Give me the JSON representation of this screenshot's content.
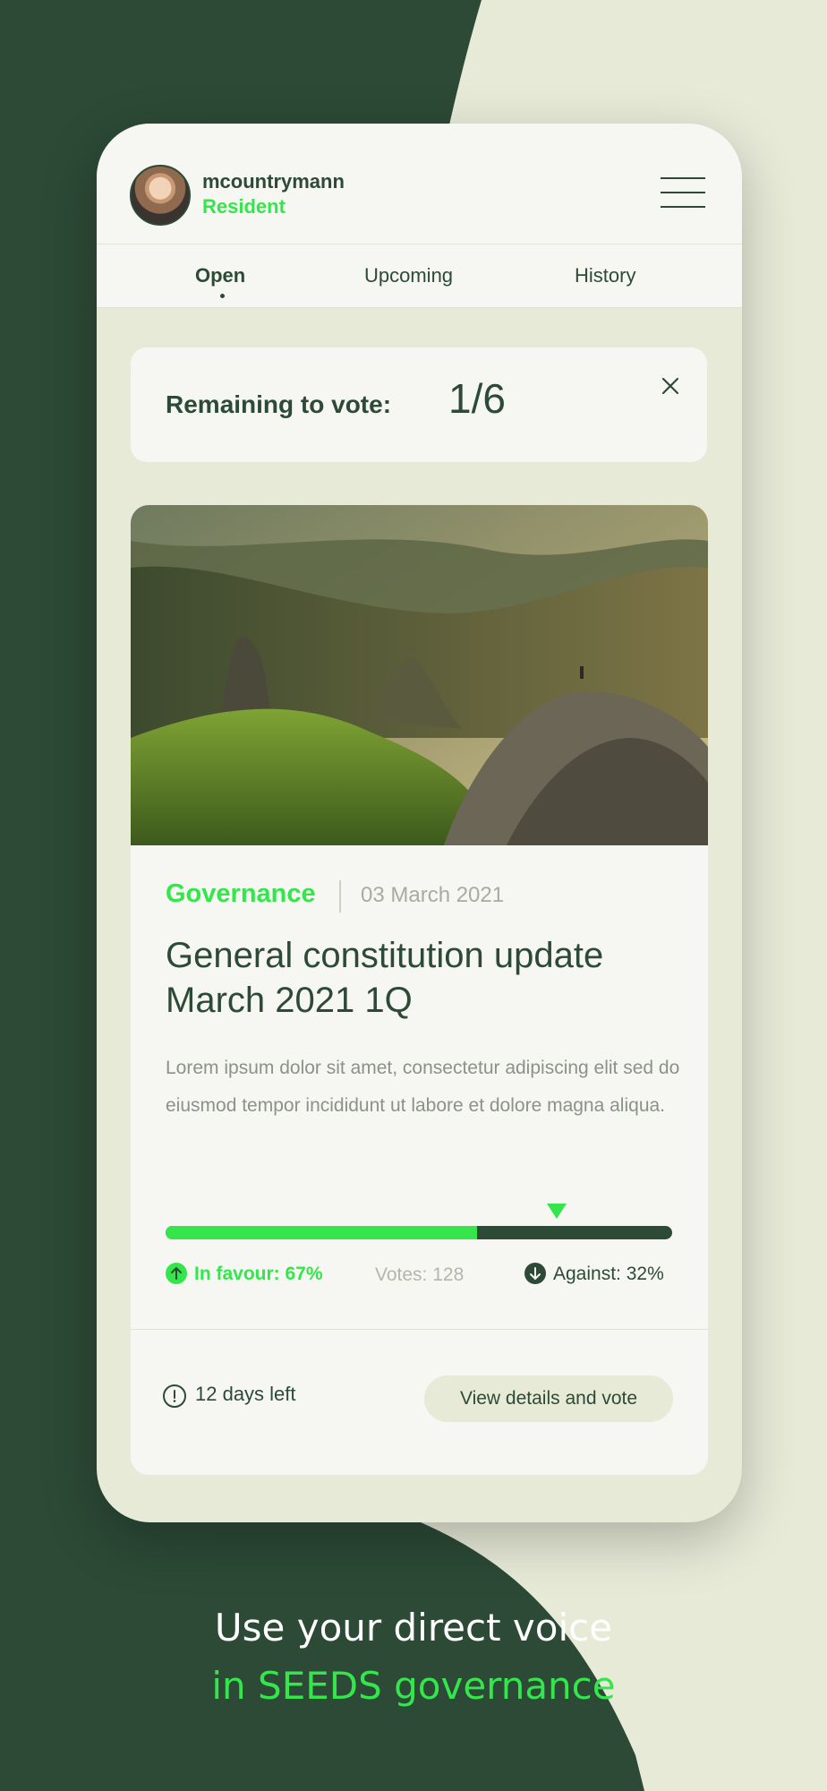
{
  "user": {
    "name": "mcountrymann",
    "role": "Resident"
  },
  "tabs": [
    {
      "label": "Open"
    },
    {
      "label": "Upcoming"
    },
    {
      "label": "History"
    }
  ],
  "remaining": {
    "label": "Remaining to vote:",
    "count": "1/6"
  },
  "proposal": {
    "category": "Governance",
    "date": "03 March 2021",
    "title": "General constitution update March 2021 1Q",
    "description": "Lorem ipsum dolor sit amet, consectetur adipiscing elit sed do eiusmod tempor incididunt ut labore et dolore magna aliqua.",
    "in_favour_label": "In favour: 67%",
    "in_favour_fraction": 0.615,
    "votes_label": "Votes: 128",
    "against_label": "Against: 32%",
    "days_left": "12 days left",
    "vote_button": "View details and vote"
  },
  "tagline": {
    "line1": "Use your direct voice",
    "line2": "in SEEDS governance"
  },
  "colors": {
    "dark_green": "#2c4a36",
    "accent_green": "#34e64c",
    "cream": "#e8ead8",
    "card": "#f6f7f2"
  },
  "icons": [
    "menu-icon",
    "close-icon",
    "arrow-up-icon",
    "arrow-down-icon",
    "alert-icon"
  ]
}
